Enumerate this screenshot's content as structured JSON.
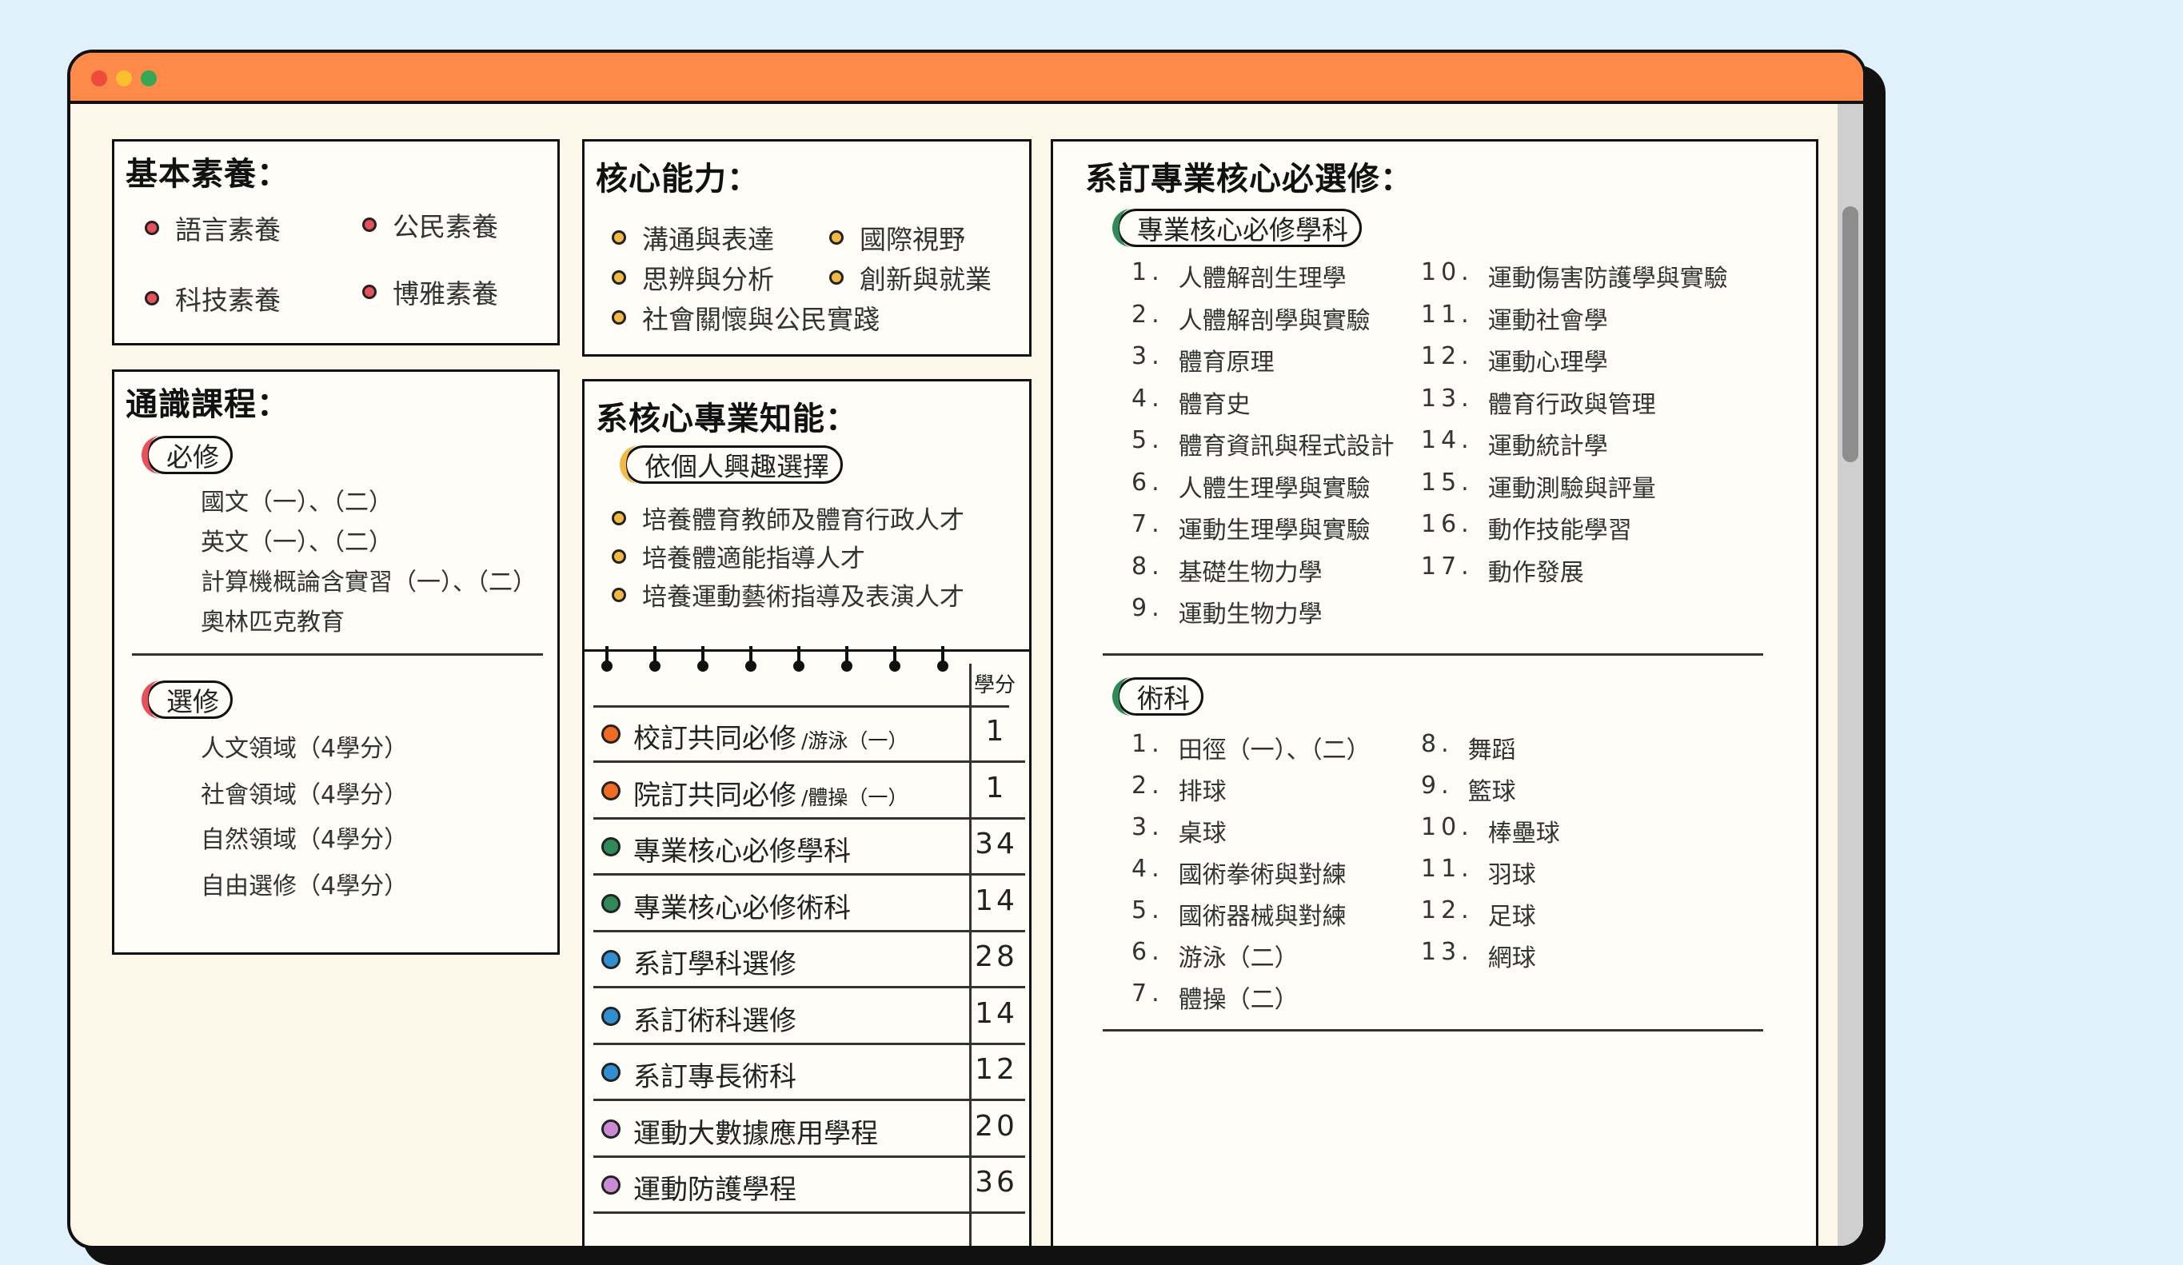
{
  "colors": {
    "background": "#e0f1fb",
    "titlebar": "#fd8a48",
    "page": "#fdf8e9",
    "red_dot": "#e8505b",
    "yellow_dot": "#f4b942",
    "orange_dot": "#f26b21",
    "green_dot": "#2e8b57",
    "blue_dot": "#2f8fd0",
    "purple_dot": "#c98bd6",
    "pill_red": "#e8505b",
    "pill_green": "#2e8b57",
    "pill_yellow": "#f4b942"
  },
  "basic_literacy": {
    "title": "基本素養：",
    "items": [
      "語言素養",
      "公民素養",
      "科技素養",
      "博雅素養"
    ]
  },
  "core_competence": {
    "title": "核心能力：",
    "items": [
      "溝通與表達",
      "國際視野",
      "思辨與分析",
      "創新與就業",
      "社會關懷與公民實踐"
    ]
  },
  "general_courses": {
    "title": "通識課程：",
    "required_label": "必修",
    "required": [
      "國文（一）、（二）",
      "英文（一）、（二）",
      "計算機概論含實習（一）、（二）",
      "奧林匹克教育"
    ],
    "elective_label": "選修",
    "electives": [
      "人文領域（4學分）",
      "社會領域（4學分）",
      "自然領域（4學分）",
      "自由選修（4學分）"
    ]
  },
  "dept_knowledge": {
    "title": "系核心專業知能：",
    "pill": "依個人興趣選擇",
    "items": [
      "培養體育教師及體育行政人才",
      "培養體適能指導人才",
      "培養運動藝術指導及表演人才"
    ]
  },
  "credits": {
    "header": "學分",
    "rows": [
      {
        "label": "校訂共同必修",
        "sub": "/游泳（一）",
        "value": "1",
        "color": "#f26b21"
      },
      {
        "label": "院訂共同必修",
        "sub": "/體操（一）",
        "value": "1",
        "color": "#f26b21"
      },
      {
        "label": "專業核心必修學科",
        "sub": "",
        "value": "34",
        "color": "#2e8b57"
      },
      {
        "label": "專業核心必修術科",
        "sub": "",
        "value": "14",
        "color": "#2e8b57"
      },
      {
        "label": "系訂學科選修",
        "sub": "",
        "value": "28",
        "color": "#2f8fd0"
      },
      {
        "label": "系訂術科選修",
        "sub": "",
        "value": "14",
        "color": "#2f8fd0"
      },
      {
        "label": "系訂專長術科",
        "sub": "",
        "value": "12",
        "color": "#2f8fd0"
      },
      {
        "label": "運動大數據應用學程",
        "sub": "",
        "value": "20",
        "color": "#c98bd6"
      },
      {
        "label": "運動防護學程",
        "sub": "",
        "value": "36",
        "color": "#c98bd6"
      }
    ]
  },
  "major_core": {
    "title": "系訂專業核心必選修：",
    "academic_pill": "專業核心必修學科",
    "academic": [
      {
        "n": "1.",
        "t": "人體解剖生理學"
      },
      {
        "n": "2.",
        "t": "人體解剖學與實驗"
      },
      {
        "n": "3.",
        "t": "體育原理"
      },
      {
        "n": "4.",
        "t": "體育史"
      },
      {
        "n": "5.",
        "t": "體育資訊與程式設計"
      },
      {
        "n": "6.",
        "t": "人體生理學與實驗"
      },
      {
        "n": "7.",
        "t": "運動生理學與實驗"
      },
      {
        "n": "8.",
        "t": "基礎生物力學"
      },
      {
        "n": "9.",
        "t": "運動生物力學"
      },
      {
        "n": "10.",
        "t": "運動傷害防護學與實驗"
      },
      {
        "n": "11.",
        "t": "運動社會學"
      },
      {
        "n": "12.",
        "t": "運動心理學"
      },
      {
        "n": "13.",
        "t": "體育行政與管理"
      },
      {
        "n": "14.",
        "t": "運動統計學"
      },
      {
        "n": "15.",
        "t": "運動測驗與評量"
      },
      {
        "n": "16.",
        "t": "動作技能學習"
      },
      {
        "n": "17.",
        "t": "動作發展"
      }
    ],
    "skills_pill": "術科",
    "skills": [
      {
        "n": "1.",
        "t": "田徑（一）、（二）"
      },
      {
        "n": "2.",
        "t": "排球"
      },
      {
        "n": "3.",
        "t": "桌球"
      },
      {
        "n": "4.",
        "t": "國術拳術與對練"
      },
      {
        "n": "5.",
        "t": "國術器械與對練"
      },
      {
        "n": "6.",
        "t": "游泳（二）"
      },
      {
        "n": "7.",
        "t": "體操（二）"
      },
      {
        "n": "8.",
        "t": "舞蹈"
      },
      {
        "n": "9.",
        "t": "籃球"
      },
      {
        "n": "10.",
        "t": "棒壘球"
      },
      {
        "n": "11.",
        "t": "羽球"
      },
      {
        "n": "12.",
        "t": "足球"
      },
      {
        "n": "13.",
        "t": "網球"
      }
    ]
  }
}
